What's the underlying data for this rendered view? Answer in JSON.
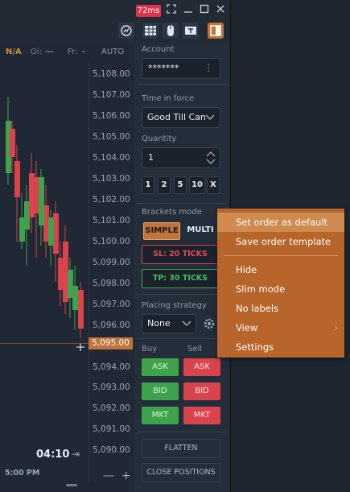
{
  "window": {
    "latency": "72ms",
    "fullscreen_icon": "fullscreen-icon",
    "minimize_icon": "minimize-icon",
    "maximize_icon": "maximize-icon",
    "close_icon": "close-icon"
  },
  "chart": {
    "info": {
      "symbol": "N/A",
      "oi_label": "Oi:",
      "oi_value": "---",
      "fr_label": "Fr:",
      "fr_value": "-"
    },
    "auto_label": "AUTO",
    "prices": [
      "5,108.00",
      "5,107.00",
      "5,106.00",
      "5,105.00",
      "5,104.00",
      "5,103.00",
      "5,102.00",
      "5,101.00",
      "5,100.00",
      "5,099.00",
      "5,098.00",
      "5,097.00",
      "5,096.00",
      "5,094.00",
      "5,093.00",
      "5,092.00",
      "5,091.00",
      "5,090.00"
    ],
    "current_price": "5,095.00",
    "timer": "04:10",
    "time_label": "5:00 PM",
    "zoom_out": "—",
    "zoom_in": "+",
    "accent_up": "#3fa34d",
    "accent_down": "#d9434c"
  },
  "panel": {
    "account_label": "Account",
    "account_value": "*******",
    "tif_label": "Time in force",
    "tif_value": "Good Till Can",
    "quantity_label": "Quantity",
    "quantity_value": "1",
    "quick_qty": [
      "1",
      "2",
      "5",
      "10",
      "X"
    ],
    "brackets_label": "Brackets mode",
    "mode_simple": "SIMPLE",
    "mode_multi": "MULTI",
    "sl": "SL: 20 TICKS",
    "tp": "TP: 30 TICKS",
    "placing_label": "Placing strategy",
    "placing_value": "None",
    "buy_label": "Buy",
    "sell_label": "Sell",
    "ask": "ASK",
    "bid": "BID",
    "mkt": "MKT",
    "flatten": "FLATTEN",
    "close_positions": "CLOSE POSITIONS"
  },
  "menu": {
    "items": [
      "Set order as default",
      "Save order template",
      "Hide",
      "Slim mode",
      "No labels",
      "View",
      "Settings"
    ]
  }
}
